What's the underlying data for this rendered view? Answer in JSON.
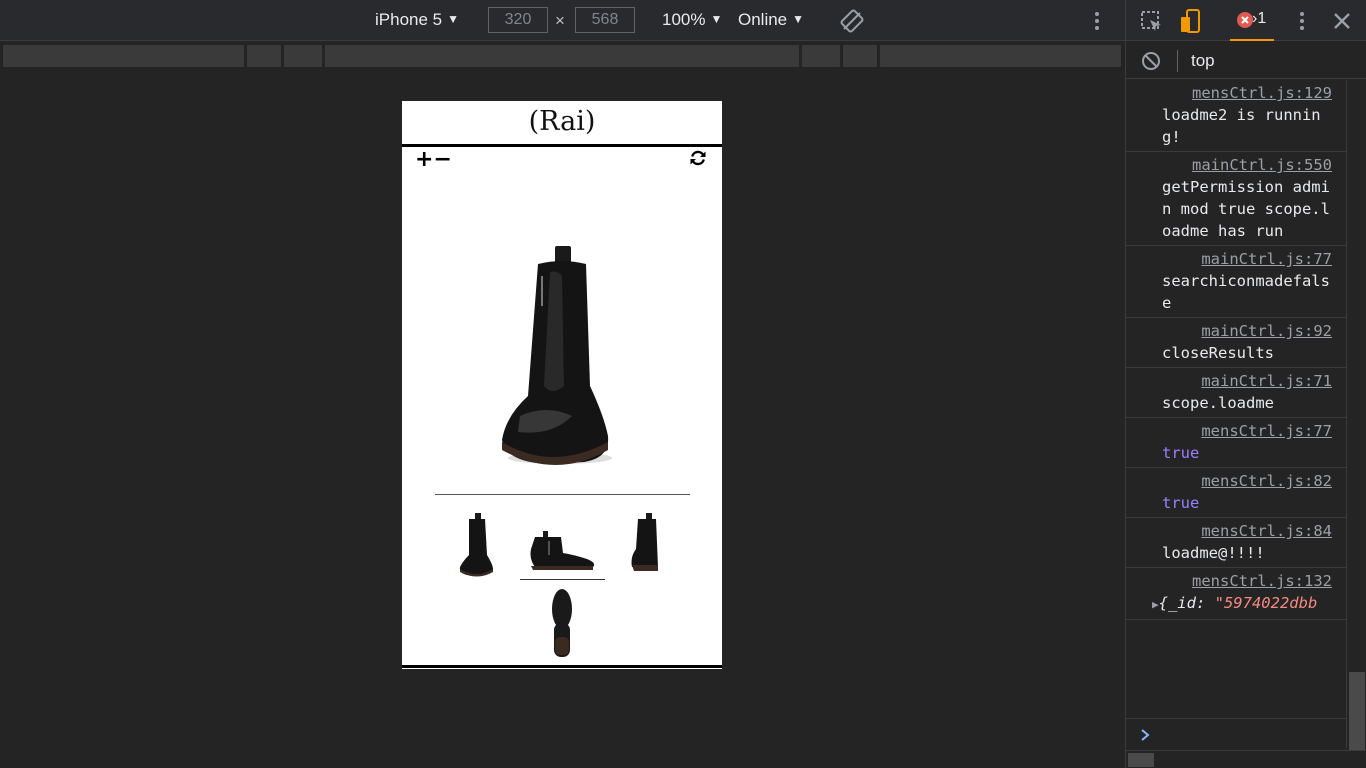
{
  "toolbar": {
    "device": "iPhone 5",
    "width": "320",
    "height": "568",
    "times": "×",
    "zoom": "100%",
    "network": "Online"
  },
  "device_page": {
    "brand": "(Rai)",
    "zoom_in": "+",
    "zoom_out": "−"
  },
  "devtools": {
    "error_count": "1",
    "context": "top",
    "console": [
      {
        "source": "mensCtrl.js:129",
        "message": "loadme2 is running!",
        "kind": "text"
      },
      {
        "source": "mainCtrl.js:550",
        "message": "getPermission admin mod true scope.loadme has run",
        "kind": "text"
      },
      {
        "source": "mainCtrl.js:77",
        "message": "searchiconmadefalse",
        "kind": "text"
      },
      {
        "source": "mainCtrl.js:92",
        "message": "closeResults",
        "kind": "text"
      },
      {
        "source": "mainCtrl.js:71",
        "message": "scope.loadme",
        "kind": "text"
      },
      {
        "source": "mensCtrl.js:77",
        "message": "true",
        "kind": "bool"
      },
      {
        "source": "mensCtrl.js:82",
        "message": "true",
        "kind": "bool"
      },
      {
        "source": "mensCtrl.js:84",
        "message": "loadme@!!!!",
        "kind": "text"
      },
      {
        "source": "mensCtrl.js:132",
        "message": "",
        "kind": "object"
      }
    ],
    "object_key": "{_id: ",
    "object_value": "\"5974022dbb"
  },
  "icons": {
    "device_menu": "triangle-down-icon",
    "rotate": "rotate-icon",
    "more": "kebab-menu-icon",
    "inspect": "inspect-element-icon",
    "device_toggle": "device-toggle-icon",
    "error": "error-icon",
    "close": "close-icon",
    "clear": "clear-console-icon",
    "reset": "refresh-icon",
    "prompt": "chevron-right-icon",
    "expand": "expand-triangle-icon"
  },
  "colors": {
    "accent": "#f29900",
    "error": "#f28b82",
    "bool": "#9980ff",
    "prompt": "#8ab4f8"
  }
}
